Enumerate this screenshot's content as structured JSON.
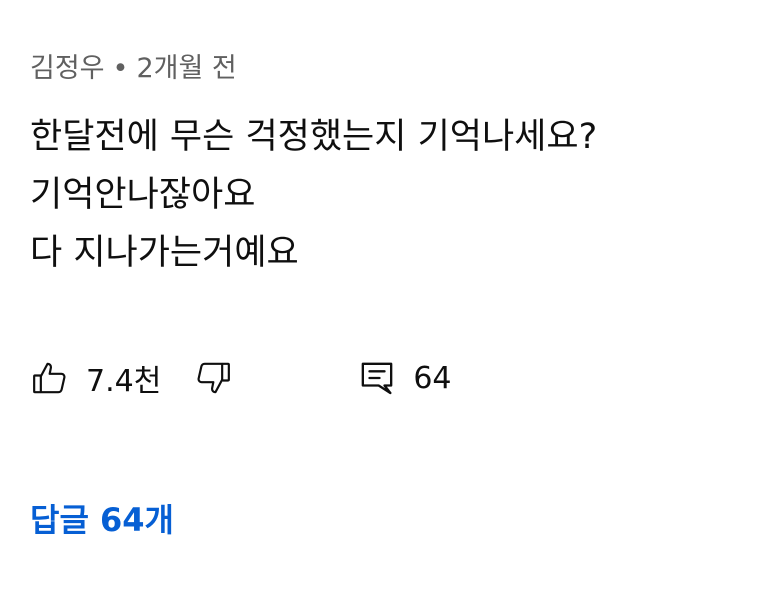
{
  "comment": {
    "author": "김정우",
    "separator": "•",
    "time": "2개월 전",
    "text_lines": [
      "한달전에 무슨 걱정했는지 기억나세요?",
      "기억안나잖아요",
      "다 지나가는거예요"
    ],
    "like_count": "7.4천",
    "reply_count_badge": "64",
    "replies_link": "답글 64개"
  },
  "icons": {
    "like": "thumbs-up-icon",
    "dislike": "thumbs-down-icon",
    "comment": "comment-icon"
  },
  "colors": {
    "text": "#0f0f0f",
    "meta": "#606060",
    "link": "#065fd4"
  }
}
